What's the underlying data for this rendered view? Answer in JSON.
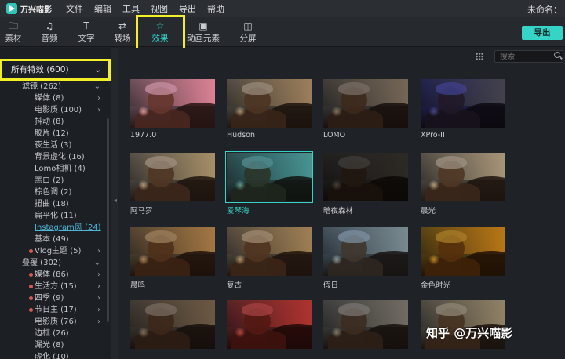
{
  "app": {
    "logo_text": "万兴喵影",
    "untitled": "未命名："
  },
  "menu": [
    "文件",
    "编辑",
    "工具",
    "视图",
    "导出",
    "帮助"
  ],
  "toolbar": {
    "tools": [
      {
        "label": "素材",
        "icon": "folder-icon"
      },
      {
        "label": "音频",
        "icon": "music-note-icon"
      },
      {
        "label": "文字",
        "icon": "text-icon"
      },
      {
        "label": "转场",
        "icon": "transition-icon"
      },
      {
        "label": "效果",
        "icon": "effects-icon",
        "active": true
      },
      {
        "label": "动画元素",
        "icon": "image-icon"
      },
      {
        "label": "分屏",
        "icon": "split-screen-icon"
      }
    ],
    "export_label": "导出"
  },
  "sidebar": {
    "header": "所有特效 (600)",
    "items": [
      {
        "label": "滤镜 (262)",
        "level": 0,
        "arrow": "down"
      },
      {
        "label": "媒体 (8)",
        "level": 1,
        "arrow": "right"
      },
      {
        "label": "电影质 (100)",
        "level": 1,
        "arrow": "right"
      },
      {
        "label": "抖动 (8)",
        "level": 1
      },
      {
        "label": "胶片 (12)",
        "level": 1
      },
      {
        "label": "夜生活 (3)",
        "level": 1
      },
      {
        "label": "背景虚化 (16)",
        "level": 1
      },
      {
        "label": "Lomo相机 (4)",
        "level": 1
      },
      {
        "label": "黑白 (2)",
        "level": 1
      },
      {
        "label": "棕色调 (2)",
        "level": 1
      },
      {
        "label": "扭曲 (18)",
        "level": 1
      },
      {
        "label": "扁平化 (11)",
        "level": 1
      },
      {
        "label": "Instagram风 (24)",
        "level": 1,
        "link": true
      },
      {
        "label": "基本 (49)",
        "level": 1
      },
      {
        "label": "Vlog主题 (5)",
        "level": 1,
        "dot": true,
        "arrow": "right"
      },
      {
        "label": "叠覆 (302)",
        "level": 0,
        "arrow": "down"
      },
      {
        "label": "媒体 (86)",
        "level": 1,
        "dot": true,
        "arrow": "right"
      },
      {
        "label": "生活方 (15)",
        "level": 1,
        "dot": true,
        "arrow": "right"
      },
      {
        "label": "四季 (9)",
        "level": 1,
        "dot": true,
        "arrow": "right"
      },
      {
        "label": "节日主 (17)",
        "level": 1,
        "dot": true,
        "arrow": "right"
      },
      {
        "label": "电影质 (76)",
        "level": 1,
        "arrow": "right"
      },
      {
        "label": "边框 (26)",
        "level": 1
      },
      {
        "label": "漏光 (8)",
        "level": 1
      },
      {
        "label": "虚化 (10)",
        "level": 1
      }
    ]
  },
  "search": {
    "placeholder": "搜索"
  },
  "effects": [
    {
      "label": "1977.0",
      "tint": "#e8a7b7",
      "sky": "#f2c6d0"
    },
    {
      "label": "Hudson",
      "tint": "#b0a08a",
      "sky": "#e2c9a8"
    },
    {
      "label": "LOMO",
      "tint": "#8a7e72",
      "sky": "#d8cfc0"
    },
    {
      "label": "XPro-II",
      "tint": "#4a4aa0",
      "sky": "#e8e27a"
    },
    {
      "label": "阿马罗",
      "tint": "#b8a690",
      "sky": "#e6dcb8"
    },
    {
      "label": "爱琴海",
      "tint": "#5fa3a5",
      "sky": "#bfe6e0",
      "selected": true
    },
    {
      "label": "暗夜森林",
      "tint": "#4a4540",
      "sky": "#9a9590"
    },
    {
      "label": "晨光",
      "tint": "#b6a792",
      "sky": "#ece4d2"
    },
    {
      "label": "晨鸣",
      "tint": "#b59269",
      "sky": "#e6cfa0"
    },
    {
      "label": "复古",
      "tint": "#b8a080",
      "sky": "#dccaa6"
    },
    {
      "label": "假日",
      "tint": "#8fa7b8",
      "sky": "#d6d2c8"
    },
    {
      "label": "金色时光",
      "tint": "#c4902c",
      "sky": "#f1d37a"
    },
    {
      "label": "",
      "tint": "#8a7a6a",
      "sky": "#c8b8a0"
    },
    {
      "label": "",
      "tint": "#c04a4a",
      "sky": "#e8b0a0"
    },
    {
      "label": "",
      "tint": "#8a8680",
      "sky": "#d0ccc4"
    },
    {
      "label": "",
      "tint": "#a59a84",
      "sky": "#e0d8c6"
    }
  ],
  "watermark": "知乎 @万兴喵影"
}
